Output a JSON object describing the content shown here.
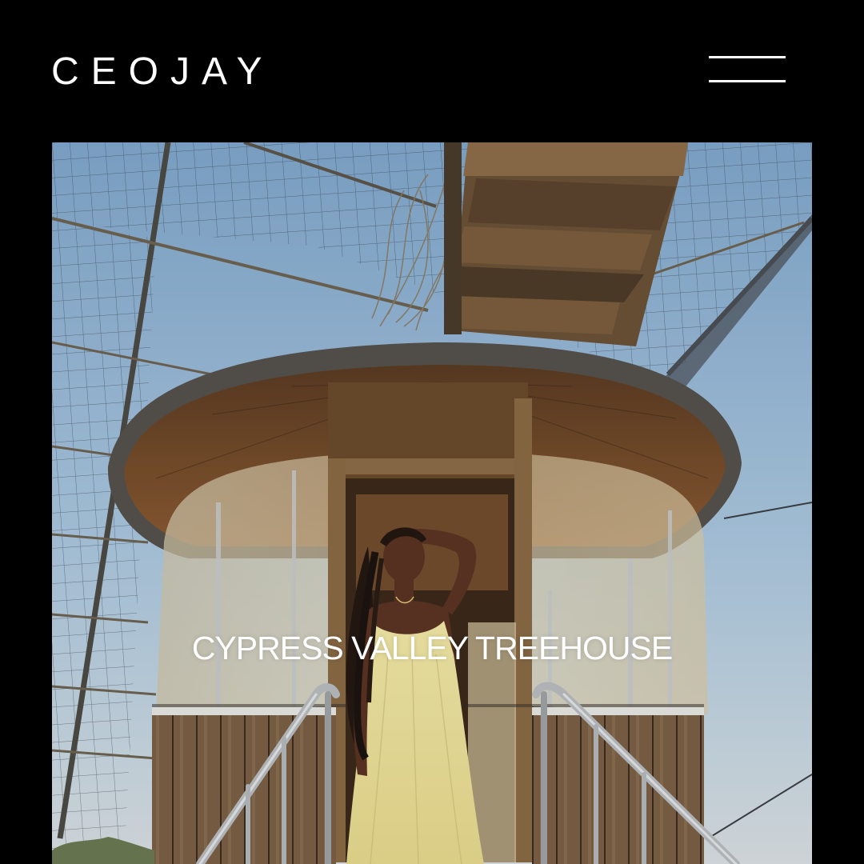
{
  "header": {
    "logo_text": "CEOJAY",
    "menu_icon": "hamburger-menu-icon"
  },
  "hero": {
    "title": "CYPRESS VALLEY TREEHOUSE",
    "image": "photo-woman-yellow-dress-at-glass-treehouse"
  },
  "colors": {
    "background": "#000000",
    "text": "#ffffff",
    "sky": "#9fc0dc",
    "wood": "#8a6a45",
    "dress": "#efe6a8"
  }
}
